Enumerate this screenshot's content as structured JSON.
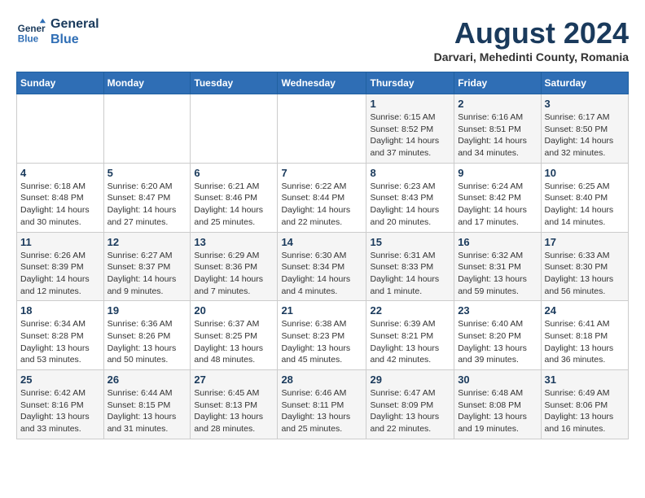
{
  "header": {
    "logo_line1": "General",
    "logo_line2": "Blue",
    "month_year": "August 2024",
    "location": "Darvari, Mehedinti County, Romania"
  },
  "days_of_week": [
    "Sunday",
    "Monday",
    "Tuesday",
    "Wednesday",
    "Thursday",
    "Friday",
    "Saturday"
  ],
  "weeks": [
    [
      {
        "day": "",
        "info": ""
      },
      {
        "day": "",
        "info": ""
      },
      {
        "day": "",
        "info": ""
      },
      {
        "day": "",
        "info": ""
      },
      {
        "day": "1",
        "info": "Sunrise: 6:15 AM\nSunset: 8:52 PM\nDaylight: 14 hours\nand 37 minutes."
      },
      {
        "day": "2",
        "info": "Sunrise: 6:16 AM\nSunset: 8:51 PM\nDaylight: 14 hours\nand 34 minutes."
      },
      {
        "day": "3",
        "info": "Sunrise: 6:17 AM\nSunset: 8:50 PM\nDaylight: 14 hours\nand 32 minutes."
      }
    ],
    [
      {
        "day": "4",
        "info": "Sunrise: 6:18 AM\nSunset: 8:48 PM\nDaylight: 14 hours\nand 30 minutes."
      },
      {
        "day": "5",
        "info": "Sunrise: 6:20 AM\nSunset: 8:47 PM\nDaylight: 14 hours\nand 27 minutes."
      },
      {
        "day": "6",
        "info": "Sunrise: 6:21 AM\nSunset: 8:46 PM\nDaylight: 14 hours\nand 25 minutes."
      },
      {
        "day": "7",
        "info": "Sunrise: 6:22 AM\nSunset: 8:44 PM\nDaylight: 14 hours\nand 22 minutes."
      },
      {
        "day": "8",
        "info": "Sunrise: 6:23 AM\nSunset: 8:43 PM\nDaylight: 14 hours\nand 20 minutes."
      },
      {
        "day": "9",
        "info": "Sunrise: 6:24 AM\nSunset: 8:42 PM\nDaylight: 14 hours\nand 17 minutes."
      },
      {
        "day": "10",
        "info": "Sunrise: 6:25 AM\nSunset: 8:40 PM\nDaylight: 14 hours\nand 14 minutes."
      }
    ],
    [
      {
        "day": "11",
        "info": "Sunrise: 6:26 AM\nSunset: 8:39 PM\nDaylight: 14 hours\nand 12 minutes."
      },
      {
        "day": "12",
        "info": "Sunrise: 6:27 AM\nSunset: 8:37 PM\nDaylight: 14 hours\nand 9 minutes."
      },
      {
        "day": "13",
        "info": "Sunrise: 6:29 AM\nSunset: 8:36 PM\nDaylight: 14 hours\nand 7 minutes."
      },
      {
        "day": "14",
        "info": "Sunrise: 6:30 AM\nSunset: 8:34 PM\nDaylight: 14 hours\nand 4 minutes."
      },
      {
        "day": "15",
        "info": "Sunrise: 6:31 AM\nSunset: 8:33 PM\nDaylight: 14 hours\nand 1 minute."
      },
      {
        "day": "16",
        "info": "Sunrise: 6:32 AM\nSunset: 8:31 PM\nDaylight: 13 hours\nand 59 minutes."
      },
      {
        "day": "17",
        "info": "Sunrise: 6:33 AM\nSunset: 8:30 PM\nDaylight: 13 hours\nand 56 minutes."
      }
    ],
    [
      {
        "day": "18",
        "info": "Sunrise: 6:34 AM\nSunset: 8:28 PM\nDaylight: 13 hours\nand 53 minutes."
      },
      {
        "day": "19",
        "info": "Sunrise: 6:36 AM\nSunset: 8:26 PM\nDaylight: 13 hours\nand 50 minutes."
      },
      {
        "day": "20",
        "info": "Sunrise: 6:37 AM\nSunset: 8:25 PM\nDaylight: 13 hours\nand 48 minutes."
      },
      {
        "day": "21",
        "info": "Sunrise: 6:38 AM\nSunset: 8:23 PM\nDaylight: 13 hours\nand 45 minutes."
      },
      {
        "day": "22",
        "info": "Sunrise: 6:39 AM\nSunset: 8:21 PM\nDaylight: 13 hours\nand 42 minutes."
      },
      {
        "day": "23",
        "info": "Sunrise: 6:40 AM\nSunset: 8:20 PM\nDaylight: 13 hours\nand 39 minutes."
      },
      {
        "day": "24",
        "info": "Sunrise: 6:41 AM\nSunset: 8:18 PM\nDaylight: 13 hours\nand 36 minutes."
      }
    ],
    [
      {
        "day": "25",
        "info": "Sunrise: 6:42 AM\nSunset: 8:16 PM\nDaylight: 13 hours\nand 33 minutes."
      },
      {
        "day": "26",
        "info": "Sunrise: 6:44 AM\nSunset: 8:15 PM\nDaylight: 13 hours\nand 31 minutes."
      },
      {
        "day": "27",
        "info": "Sunrise: 6:45 AM\nSunset: 8:13 PM\nDaylight: 13 hours\nand 28 minutes."
      },
      {
        "day": "28",
        "info": "Sunrise: 6:46 AM\nSunset: 8:11 PM\nDaylight: 13 hours\nand 25 minutes."
      },
      {
        "day": "29",
        "info": "Sunrise: 6:47 AM\nSunset: 8:09 PM\nDaylight: 13 hours\nand 22 minutes."
      },
      {
        "day": "30",
        "info": "Sunrise: 6:48 AM\nSunset: 8:08 PM\nDaylight: 13 hours\nand 19 minutes."
      },
      {
        "day": "31",
        "info": "Sunrise: 6:49 AM\nSunset: 8:06 PM\nDaylight: 13 hours\nand 16 minutes."
      }
    ]
  ]
}
